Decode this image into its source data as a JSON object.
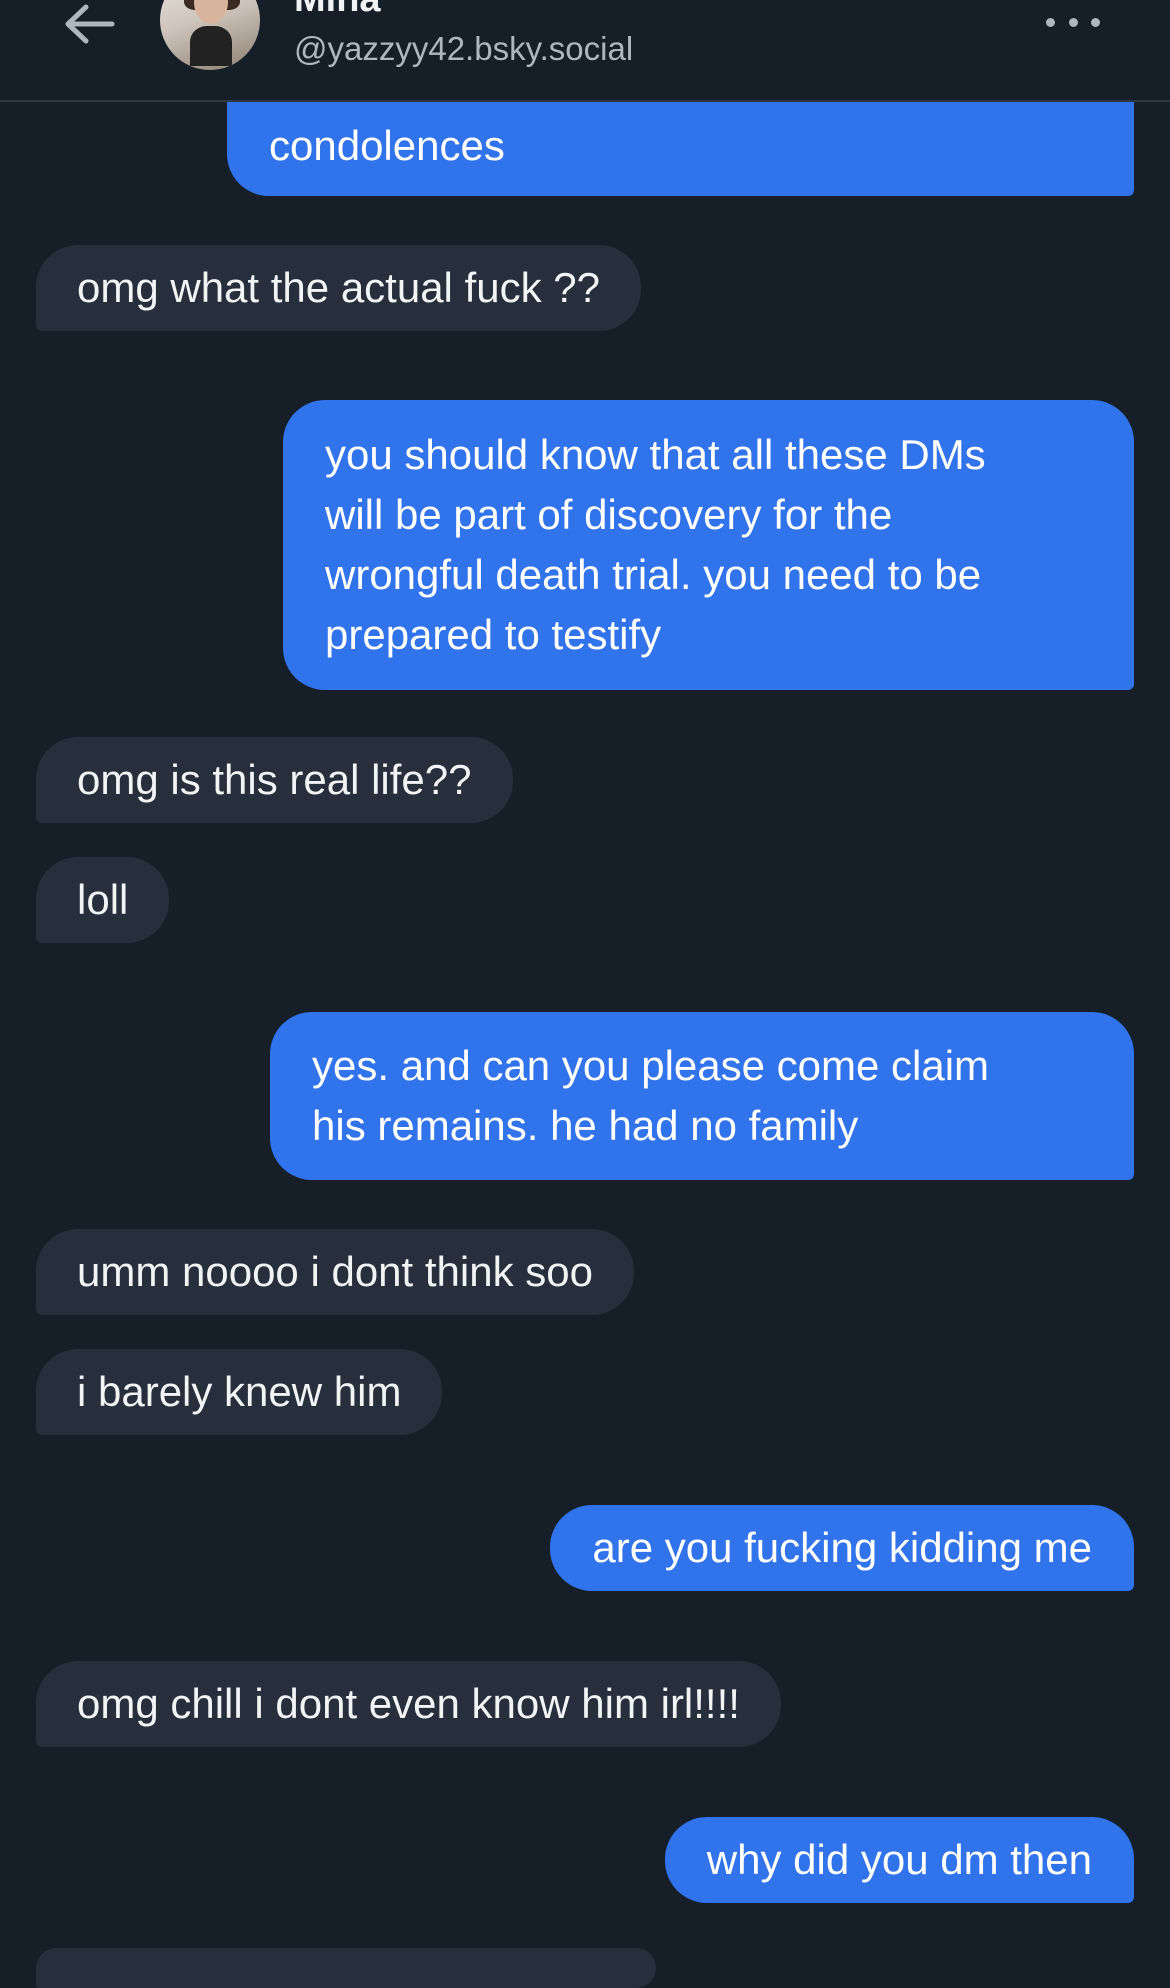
{
  "header": {
    "contact_name": "Mina",
    "handle": "@yazzyy42.bsky.social"
  },
  "messages": [
    {
      "from": "me",
      "text": "condolences"
    },
    {
      "from": "them",
      "text": "omg what the actual fuck ??"
    },
    {
      "from": "me",
      "lines": [
        "you should know that all these DMs",
        "will be part of discovery for the",
        "wrongful death trial. you need to be",
        "prepared to testify"
      ]
    },
    {
      "from": "them",
      "text": "omg is this real life??"
    },
    {
      "from": "them",
      "text": "loll"
    },
    {
      "from": "me",
      "lines": [
        "yes. and can you please come claim",
        "his remains. he had no family"
      ]
    },
    {
      "from": "them",
      "text": "umm noooo i dont think soo"
    },
    {
      "from": "them",
      "text": "i barely knew him"
    },
    {
      "from": "me",
      "text": "are you fucking kidding me"
    },
    {
      "from": "them",
      "text": "omg chill i dont even know him irl!!!!"
    },
    {
      "from": "me",
      "text": "why did you dm then"
    }
  ],
  "colors": {
    "background": "#161e27",
    "incoming_bubble": "#262f3b",
    "outgoing_bubble": "#3173ea",
    "secondary_text": "#aeb6c0"
  },
  "icons": {
    "back": "arrow-left-icon",
    "more": "ellipsis-icon"
  }
}
